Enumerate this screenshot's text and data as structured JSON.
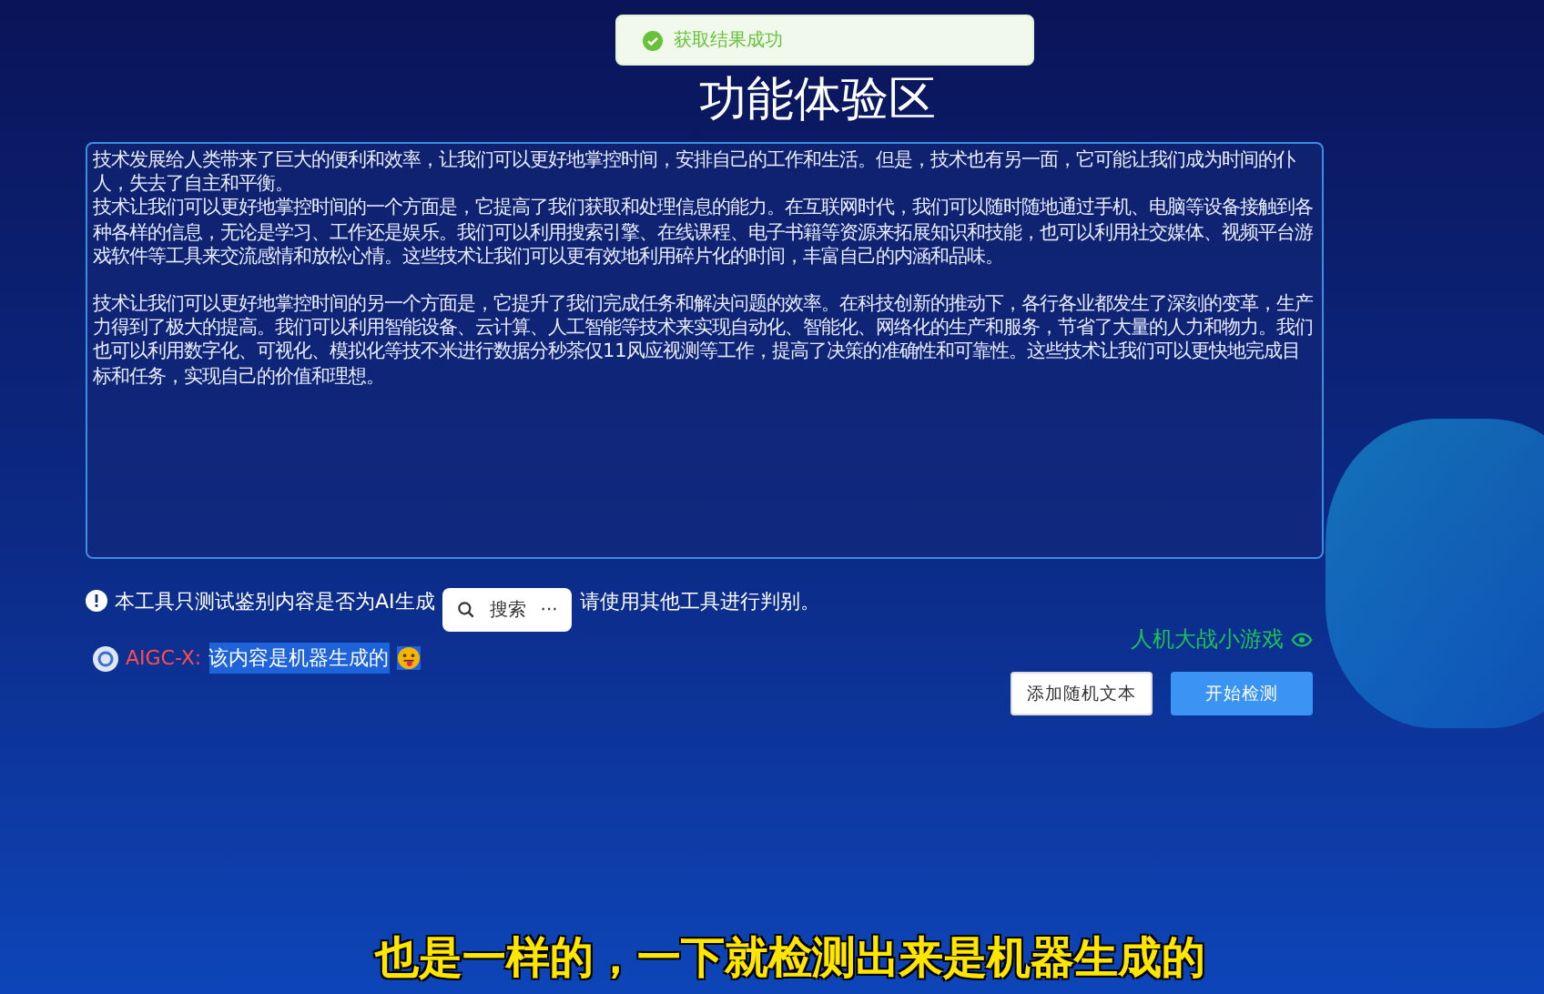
{
  "toast": {
    "message": "获取结果成功"
  },
  "title": "功能体验区",
  "text_area": {
    "blocks": [
      [
        "技术发展给人类带来了巨大的便利和效率，让我们可以更好地掌控时间，安排自己的工作和生活。但是，技术也有另一面，它可能让我们成为时间的仆人，失去了自主和平衡。",
        "技术让我们可以更好地掌控时间的一个方面是，它提高了我们获取和处理信息的能力。在互联网时代，我们可以随时随地通过手机、电脑等设备接触到各种各样的信息，无论是学习、工作还是娱乐。我们可以利用搜索引擎、在线课程、电子书籍等资源来拓展知识和技能，也可以利用社交媒体、视频平台游戏软件等工具来交流感情和放松心情。这些技术让我们可以更有效地利用碎片化的时间，丰富自己的内涵和品味。"
      ],
      [
        "技术让我们可以更好地掌控时间的另一个方面是，它提升了我们完成任务和解决问题的效率。在科技创新的推动下，各行各业都发生了深刻的变革，生产力得到了极大的提高。我们可以利用智能设备、云计算、人工智能等技术来实现自动化、智能化、网络化的生产和服务，节省了大量的人力和物力。我们也可以利用数字化、可视化、模拟化等技不米进行数据分秒茶仅11风应视测等工作，提高了决策的准确性和可靠性。这些技术让我们可以更快地完成目标和任务，实现自己的价值和理想。"
      ]
    ]
  },
  "notice": {
    "before": "本工具只测试鉴别内容是否为AI生成",
    "after": "请使用其他工具进行判别。"
  },
  "selection_popup": {
    "search_label": "搜索",
    "more": "···"
  },
  "game_link": "人机大战小游戏",
  "result": {
    "label": "AIGC-X:",
    "text": "该内容是机器生成的",
    "selected": true
  },
  "buttons": [
    {
      "label": "添加随机文本",
      "kind": "secondary"
    },
    {
      "label": "开始检测",
      "kind": "primary"
    }
  ],
  "subtitle": "也是一样的，一下就检测出来是机器生成的"
}
